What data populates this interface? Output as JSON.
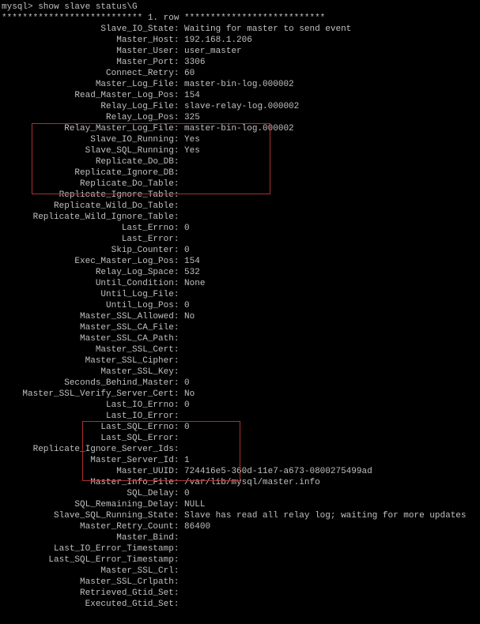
{
  "prompt": "mysql> show slave status\\G",
  "header": "*************************** 1. row ***************************",
  "rows": [
    {
      "key": "Slave_IO_State",
      "value": "Waiting for master to send event"
    },
    {
      "key": "Master_Host",
      "value": "192.168.1.206"
    },
    {
      "key": "Master_User",
      "value": "user_master"
    },
    {
      "key": "Master_Port",
      "value": "3306"
    },
    {
      "key": "Connect_Retry",
      "value": "60"
    },
    {
      "key": "Master_Log_File",
      "value": "master-bin-log.000002"
    },
    {
      "key": "Read_Master_Log_Pos",
      "value": "154"
    },
    {
      "key": "Relay_Log_File",
      "value": "slave-relay-log.000002"
    },
    {
      "key": "Relay_Log_Pos",
      "value": "325"
    },
    {
      "key": "Relay_Master_Log_File",
      "value": "master-bin-log.000002"
    },
    {
      "key": "Slave_IO_Running",
      "value": "Yes"
    },
    {
      "key": "Slave_SQL_Running",
      "value": "Yes"
    },
    {
      "key": "Replicate_Do_DB",
      "value": ""
    },
    {
      "key": "Replicate_Ignore_DB",
      "value": ""
    },
    {
      "key": "Replicate_Do_Table",
      "value": ""
    },
    {
      "key": "Replicate_Ignore_Table",
      "value": ""
    },
    {
      "key": "Replicate_Wild_Do_Table",
      "value": ""
    },
    {
      "key": "Replicate_Wild_Ignore_Table",
      "value": ""
    },
    {
      "key": "Last_Errno",
      "value": "0"
    },
    {
      "key": "Last_Error",
      "value": ""
    },
    {
      "key": "Skip_Counter",
      "value": "0"
    },
    {
      "key": "Exec_Master_Log_Pos",
      "value": "154"
    },
    {
      "key": "Relay_Log_Space",
      "value": "532"
    },
    {
      "key": "Until_Condition",
      "value": "None"
    },
    {
      "key": "Until_Log_File",
      "value": ""
    },
    {
      "key": "Until_Log_Pos",
      "value": "0"
    },
    {
      "key": "Master_SSL_Allowed",
      "value": "No"
    },
    {
      "key": "Master_SSL_CA_File",
      "value": ""
    },
    {
      "key": "Master_SSL_CA_Path",
      "value": ""
    },
    {
      "key": "Master_SSL_Cert",
      "value": ""
    },
    {
      "key": "Master_SSL_Cipher",
      "value": ""
    },
    {
      "key": "Master_SSL_Key",
      "value": ""
    },
    {
      "key": "Seconds_Behind_Master",
      "value": "0"
    },
    {
      "key": "Master_SSL_Verify_Server_Cert",
      "value": "No"
    },
    {
      "key": "Last_IO_Errno",
      "value": "0"
    },
    {
      "key": "Last_IO_Error",
      "value": ""
    },
    {
      "key": "Last_SQL_Errno",
      "value": "0"
    },
    {
      "key": "Last_SQL_Error",
      "value": ""
    },
    {
      "key": "Replicate_Ignore_Server_Ids",
      "value": ""
    },
    {
      "key": "Master_Server_Id",
      "value": "1"
    },
    {
      "key": "Master_UUID",
      "value": "724416e5-360d-11e7-a673-0800275499ad"
    },
    {
      "key": "Master_Info_File",
      "value": "/var/lib/mysql/master.info"
    },
    {
      "key": "SQL_Delay",
      "value": "0"
    },
    {
      "key": "SQL_Remaining_Delay",
      "value": "NULL"
    },
    {
      "key": "Slave_SQL_Running_State",
      "value": "Slave has read all relay log; waiting for more updates"
    },
    {
      "key": "Master_Retry_Count",
      "value": "86400"
    },
    {
      "key": "Master_Bind",
      "value": ""
    },
    {
      "key": "Last_IO_Error_Timestamp",
      "value": ""
    },
    {
      "key": "Last_SQL_Error_Timestamp",
      "value": ""
    },
    {
      "key": "Master_SSL_Crl",
      "value": ""
    },
    {
      "key": "Master_SSL_Crlpath",
      "value": ""
    },
    {
      "key": "Retrieved_Gtid_Set",
      "value": ""
    },
    {
      "key": "Executed_Gtid_Set",
      "value": ""
    }
  ]
}
